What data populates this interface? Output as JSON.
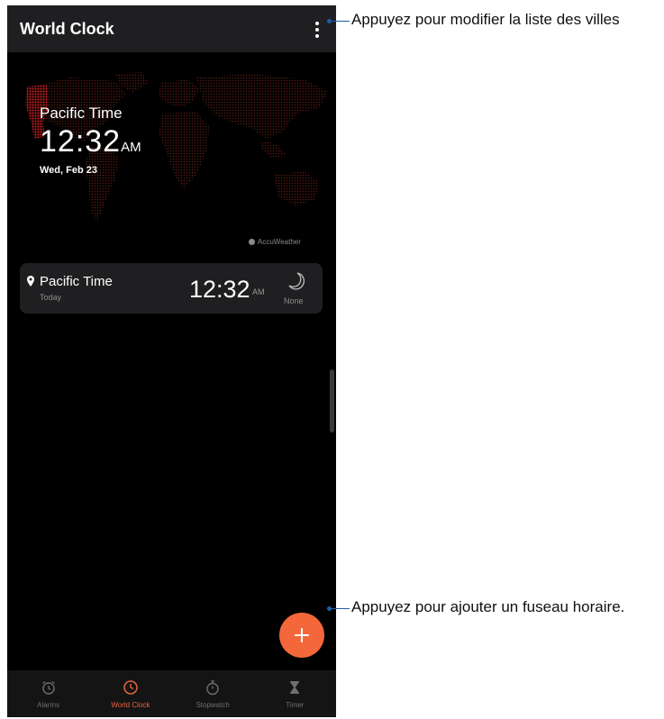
{
  "header": {
    "title": "World Clock"
  },
  "map_clock": {
    "city": "Pacific Time",
    "time": "12:32",
    "ampm": "AM",
    "date": "Wed, Feb 23",
    "attribution": "AccuWeather"
  },
  "card": {
    "city": "Pacific Time",
    "day": "Today",
    "time": "12:32",
    "ampm": "AM",
    "weather": "None"
  },
  "nav": {
    "items": [
      {
        "label": "Alarms",
        "icon": "alarm-icon"
      },
      {
        "label": "World Clock",
        "icon": "clock-icon"
      },
      {
        "label": "Stopwatch",
        "icon": "stopwatch-icon"
      },
      {
        "label": "Timer",
        "icon": "hourglass-icon"
      }
    ],
    "active_index": 1
  },
  "callouts": {
    "menu": "Appuyez pour modifier la liste des villes",
    "add": "Appuyez pour ajouter un fuseau horaire."
  },
  "colors": {
    "accent": "#f4673a",
    "nav_active": "#e8643b",
    "map_dots": "#5a1e14",
    "map_highlight": "#c01e1e",
    "callout": "#1a5fa8"
  }
}
